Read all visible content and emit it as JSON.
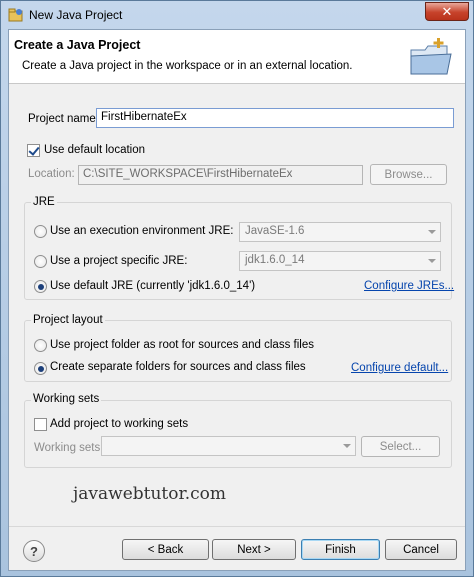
{
  "window": {
    "title": "New Java Project",
    "close_glyph": "✕"
  },
  "banner": {
    "title": "Create a Java Project",
    "description": "Create a Java project in the workspace or in an external location."
  },
  "project": {
    "name_label": "Project name:",
    "name_value": "FirstHibernateEx"
  },
  "location": {
    "use_default_label": "Use default location",
    "use_default_checked": true,
    "location_label": "Location:",
    "location_value": "C:\\SITE_WORKSPACE\\FirstHibernateEx",
    "browse_label": "Browse..."
  },
  "jre": {
    "group_title": "JRE",
    "option_env_label": "Use an execution environment JRE:",
    "option_env_value": "JavaSE-1.6",
    "option_specific_label": "Use a project specific JRE:",
    "option_specific_value": "jdk1.6.0_14",
    "option_default_label": "Use default JRE (currently 'jdk1.6.0_14')",
    "configure_link": "Configure JREs..."
  },
  "layout": {
    "group_title": "Project layout",
    "option_root_label": "Use project folder as root for sources and class files",
    "option_separate_label": "Create separate folders for sources and class files",
    "configure_link": "Configure default..."
  },
  "working_sets": {
    "group_title": "Working sets",
    "add_label": "Add project to working sets",
    "sets_label": "Working sets:",
    "select_label": "Select..."
  },
  "watermark": "javawebtutor.com",
  "buttons": {
    "help": "?",
    "back": "< Back",
    "next": "Next >",
    "finish": "Finish",
    "cancel": "Cancel"
  }
}
